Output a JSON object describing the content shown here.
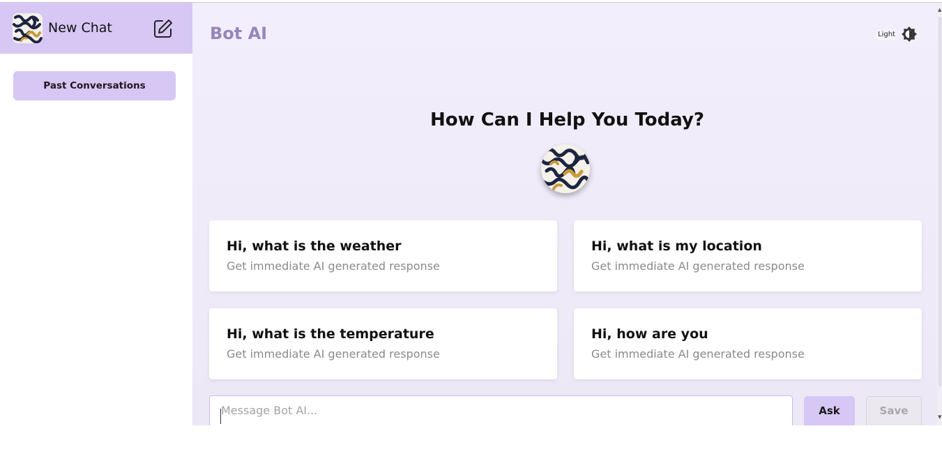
{
  "sidebar": {
    "new_chat_label": "New Chat",
    "past_conversations_label": "Past Conversations",
    "edit_icon": "edit-icon",
    "logo_icon": "bot-logo"
  },
  "header": {
    "brand": "Bot AI",
    "theme_label": "Light",
    "theme_icon": "brightness-icon"
  },
  "hero": {
    "title": "How Can I Help You Today?"
  },
  "suggestions": [
    {
      "title": "Hi, what is the weather",
      "subtitle": "Get immediate AI generated response"
    },
    {
      "title": "Hi, what is my location",
      "subtitle": "Get immediate AI generated response"
    },
    {
      "title": "Hi, what is the temperature",
      "subtitle": "Get immediate AI generated response"
    },
    {
      "title": "Hi, how are you",
      "subtitle": "Get immediate AI generated response"
    }
  ],
  "composer": {
    "placeholder": "Message Bot AI...",
    "value": "",
    "ask_label": "Ask",
    "save_label": "Save"
  },
  "colors": {
    "accent": "#d7c7f4",
    "brand": "#9785ba"
  }
}
